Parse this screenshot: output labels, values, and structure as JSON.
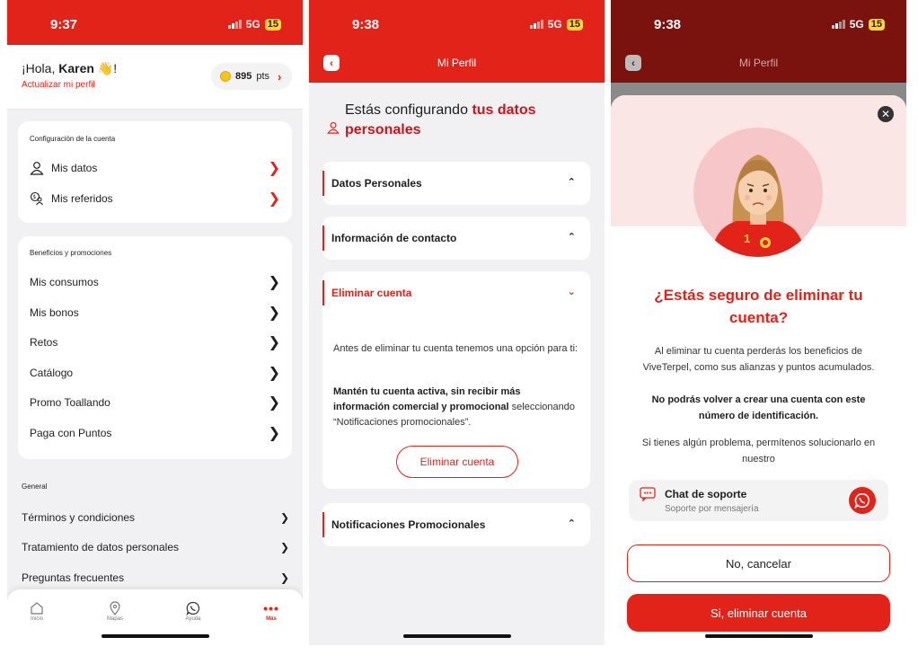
{
  "status_bars": [
    {
      "time": "9:37",
      "network": "5G",
      "battery": "15"
    },
    {
      "time": "9:38",
      "network": "5G",
      "battery": "15"
    },
    {
      "time": "9:38",
      "network": "5G",
      "battery": "15"
    }
  ],
  "home": {
    "greeting_prefix": "¡Hola,",
    "user_name": "Karen",
    "greeting_suffix": "!",
    "update_profile": "Actualizar mi perfil",
    "points_value": "895",
    "points_unit": "pts",
    "account_section": {
      "title": "Configuración de la cuenta",
      "items": [
        {
          "label": "Mis datos",
          "icon": "user-icon"
        },
        {
          "label": "Mis referidos",
          "icon": "referrals-icon"
        }
      ]
    },
    "benefits_section": {
      "title": "Beneficios y promociones",
      "items": [
        "Mis consumos",
        "Mis bonos",
        "Retos",
        "Catálogo",
        "Promo Toallando",
        "Paga con Puntos"
      ]
    },
    "general_section": {
      "title": "General",
      "items": [
        "Términos y condiciones",
        "Tratamiento de datos personales",
        "Preguntas frecuentes"
      ]
    },
    "tabs": [
      {
        "label": "Inicio",
        "icon": "home-icon"
      },
      {
        "label": "Mapas",
        "icon": "map-pin-icon"
      },
      {
        "label": "Ayuda",
        "icon": "whatsapp-icon"
      },
      {
        "label": "Más",
        "icon": "more-icon"
      }
    ]
  },
  "profile": {
    "title": "Mi Perfil",
    "config_prefix": "Estás configurando",
    "config_highlight": "tus datos personales",
    "sections": [
      "Datos Personales",
      "Información de contacto",
      "Eliminar cuenta",
      "Notificaciones Promocionales"
    ],
    "delete_text_1": "Antes de eliminar tu cuenta tenemos una opción para ti:",
    "delete_text_2_bold": "Mantén tu cuenta activa, sin recibir más información comercial y promocional",
    "delete_text_2_rest": "seleccionando “Notificaciones promocionales”.",
    "delete_button": "Eliminar cuenta"
  },
  "modal": {
    "title": "¿Estás seguro de eliminar tu cuenta?",
    "text_1": "Al eliminar tu cuenta perderás los beneficios de ViveTerpel, como sus alianzas y puntos acumulados.",
    "text_2_bold": "No podrás volver a crear una cuenta con este número de identificación.",
    "text_3": "Si tienes algún problema, permítenos solucionarlo en nuestro",
    "chat_title": "Chat de soporte",
    "chat_subtitle": "Soporte por mensajería",
    "cancel_button": "No, cancelar",
    "confirm_button": "Si, eliminar cuenta",
    "shirt_number": "1"
  },
  "colors": {
    "brand_red": "#e2231a",
    "background": "#f1f1f3"
  }
}
